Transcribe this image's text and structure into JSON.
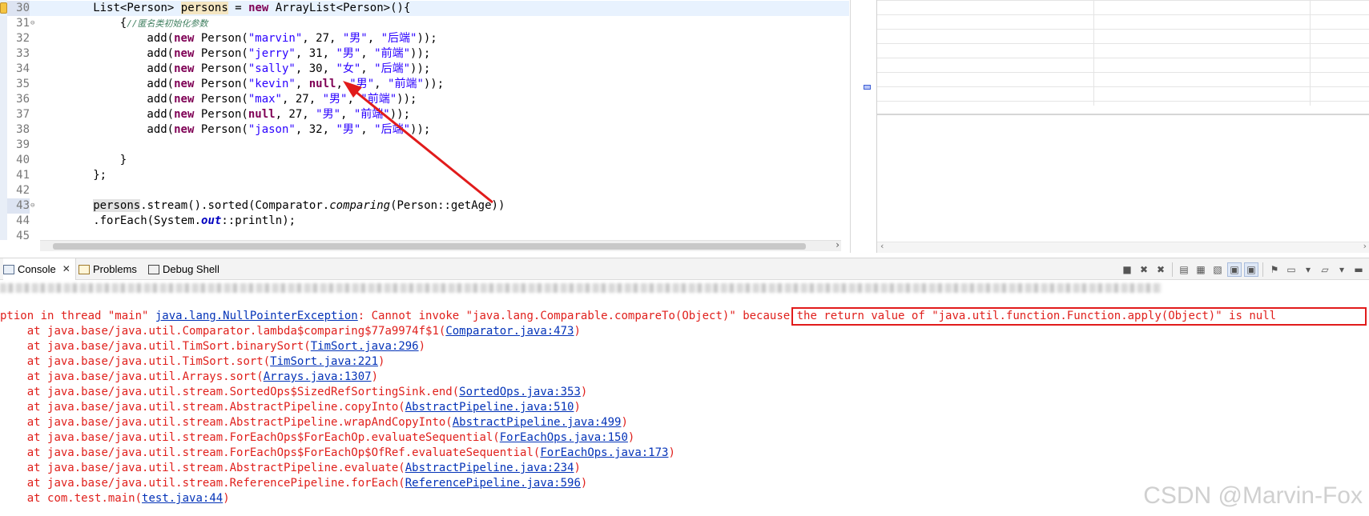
{
  "editor": {
    "lines": [
      {
        "n": "30"
      },
      {
        "n": "31"
      },
      {
        "n": "32"
      },
      {
        "n": "33"
      },
      {
        "n": "34"
      },
      {
        "n": "35"
      },
      {
        "n": "36"
      },
      {
        "n": "37"
      },
      {
        "n": "38"
      },
      {
        "n": "39"
      },
      {
        "n": "40"
      },
      {
        "n": "41"
      },
      {
        "n": "42"
      },
      {
        "n": "43"
      },
      {
        "n": "44"
      },
      {
        "n": "45"
      }
    ],
    "code": {
      "l30": {
        "t1": "List<Person> ",
        "var": "persons",
        "eq": " = ",
        "kw": "new",
        "t2": " ArrayList<Person>(){"
      },
      "l31": {
        "t1": "{",
        "comment": "//匿名类初始化参数"
      },
      "rows": [
        {
          "pre": "add(",
          "kw": "new",
          "mid": " Person(",
          "name": "\"marvin\"",
          "a": ", 27, ",
          "sex": "\"男\"",
          "c": ", ",
          "role": "\"后端\"",
          "end": "));"
        },
        {
          "pre": "add(",
          "kw": "new",
          "mid": " Person(",
          "name": "\"jerry\"",
          "a": ", 31, ",
          "sex": "\"男\"",
          "c": ", ",
          "role": "\"前端\"",
          "end": "));"
        },
        {
          "pre": "add(",
          "kw": "new",
          "mid": " Person(",
          "name": "\"sally\"",
          "a": ", 30, ",
          "sex": "\"女\"",
          "c": ", ",
          "role": "\"后端\"",
          "end": "));"
        },
        {
          "pre": "add(",
          "kw": "new",
          "mid": " Person(",
          "name": "\"kevin\"",
          "a": ", ",
          "null": "null",
          "a2": ", ",
          "sex": "\"男\"",
          "c": ", ",
          "role": "\"前端\"",
          "end": "));"
        },
        {
          "pre": "add(",
          "kw": "new",
          "mid": " Person(",
          "name": "\"max\"",
          "a": ", 27, ",
          "sex": "\"男\"",
          "c": ", ",
          "role": "\"前端\"",
          "end": "));"
        },
        {
          "pre": "add(",
          "kw": "new",
          "mid": " Person(",
          "null": "null",
          "a": ", 27, ",
          "sex": "\"男\"",
          "c": ", ",
          "role": "\"前端\"",
          "end": "));"
        },
        {
          "pre": "add(",
          "kw": "new",
          "mid": " Person(",
          "name": "\"jason\"",
          "a": ", 32, ",
          "sex": "\"男\"",
          "c": ", ",
          "role": "\"后端\"",
          "end": "));"
        }
      ],
      "l40": "}",
      "l41": "};",
      "l43": {
        "var": "persons",
        "t1": ".stream().sorted(Comparator.",
        "method": "comparing",
        "t2": "(Person::getAge))"
      },
      "l44": {
        "t1": ".forEach(System.",
        "field": "out",
        "t2": "::println);"
      }
    }
  },
  "console": {
    "tabs": [
      {
        "label": "Console"
      },
      {
        "label": "Problems"
      },
      {
        "label": "Debug Shell"
      }
    ],
    "close_glyph": "✕",
    "exception": {
      "prefix": "ption in thread \"main\" ",
      "type": "java.lang.NullPointerException",
      "message": ": Cannot invoke \"java.lang.Comparable.compareTo(Object)\" ",
      "boxed": "because the return value of \"java.util.function.Function.apply(Object)\" is null"
    },
    "stack": [
      {
        "text": "java.base/java.util.Comparator.lambda$comparing$77a9974f$1(",
        "link": "Comparator.java:473"
      },
      {
        "text": "java.base/java.util.TimSort.binarySort(",
        "link": "TimSort.java:296"
      },
      {
        "text": "java.base/java.util.TimSort.sort(",
        "link": "TimSort.java:221"
      },
      {
        "text": "java.base/java.util.Arrays.sort(",
        "link": "Arrays.java:1307"
      },
      {
        "text": "java.base/java.util.stream.SortedOps$SizedRefSortingSink.end(",
        "link": "SortedOps.java:353"
      },
      {
        "text": "java.base/java.util.stream.AbstractPipeline.copyInto(",
        "link": "AbstractPipeline.java:510"
      },
      {
        "text": "java.base/java.util.stream.AbstractPipeline.wrapAndCopyInto(",
        "link": "AbstractPipeline.java:499"
      },
      {
        "text": "java.base/java.util.stream.ForEachOps$ForEachOp.evaluateSequential(",
        "link": "ForEachOps.java:150"
      },
      {
        "text": "java.base/java.util.stream.ForEachOps$ForEachOp$OfRef.evaluateSequential(",
        "link": "ForEachOps.java:173"
      },
      {
        "text": "java.base/java.util.stream.AbstractPipeline.evaluate(",
        "link": "AbstractPipeline.java:234"
      },
      {
        "text": "java.base/java.util.stream.ReferencePipeline.forEach(",
        "link": "ReferencePipeline.java:596"
      },
      {
        "text": "com.test.main(",
        "link": "test.java:44"
      }
    ],
    "at_prefix": "    at ",
    "close_paren": ")"
  },
  "watermark": "CSDN @Marvin-Fox",
  "colors": {
    "error": "#e0201c",
    "link": "#0433b8",
    "keyword": "#7f0055",
    "string": "#2a00ff",
    "highlight_box": "#e11b1b"
  }
}
